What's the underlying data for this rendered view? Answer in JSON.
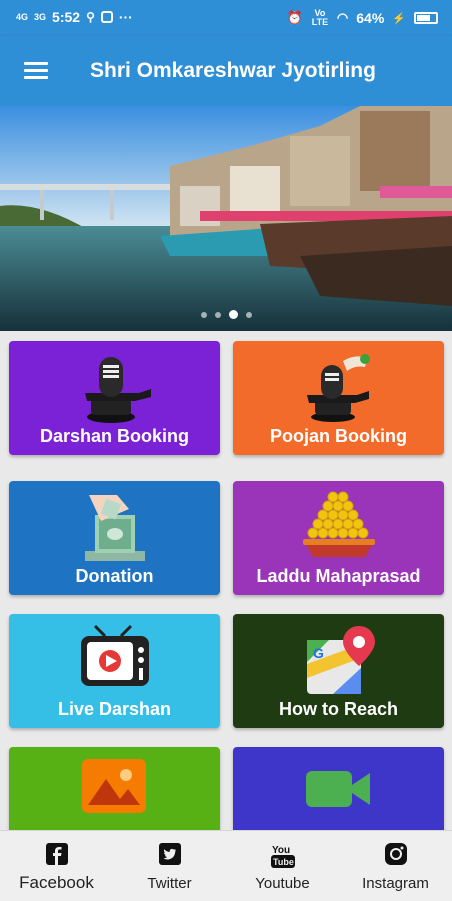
{
  "status_bar": {
    "network_left": "4G",
    "network_right": "3G",
    "time": "5:52",
    "volte": "Vo LTE",
    "battery": "64%"
  },
  "app_bar": {
    "title": "Shri Omkareshwar Jyotirling"
  },
  "carousel": {
    "active_index": 2,
    "dot_count": 4
  },
  "tiles": [
    {
      "label": "Darshan Booking",
      "color": "#7b22d6",
      "icon": "shivling-icon"
    },
    {
      "label": "Poojan Booking",
      "color": "#f26b2a",
      "icon": "shivling-offering-icon"
    },
    {
      "label": "Donation",
      "color": "#1e74c2",
      "icon": "donation-hand-icon"
    },
    {
      "label": "Laddu Mahaprasad",
      "color": "#9a34b8",
      "icon": "laddu-icon"
    },
    {
      "label": "Live Darshan",
      "color": "#36bfe6",
      "icon": "tv-icon"
    },
    {
      "label": "How to Reach",
      "color": "#1f3b12",
      "icon": "map-icon"
    },
    {
      "label": "",
      "color": "#58b114",
      "icon": "gallery-icon"
    },
    {
      "label": "",
      "color": "#3e36c9",
      "icon": "video-icon"
    }
  ],
  "bottom_nav": [
    {
      "label": "Facebook",
      "icon": "facebook-icon"
    },
    {
      "label": "Twitter",
      "icon": "twitter-icon"
    },
    {
      "label": "Youtube",
      "icon": "youtube-icon"
    },
    {
      "label": "Instagram",
      "icon": "instagram-icon"
    }
  ],
  "colors": {
    "primary": "#2f8fd6"
  }
}
